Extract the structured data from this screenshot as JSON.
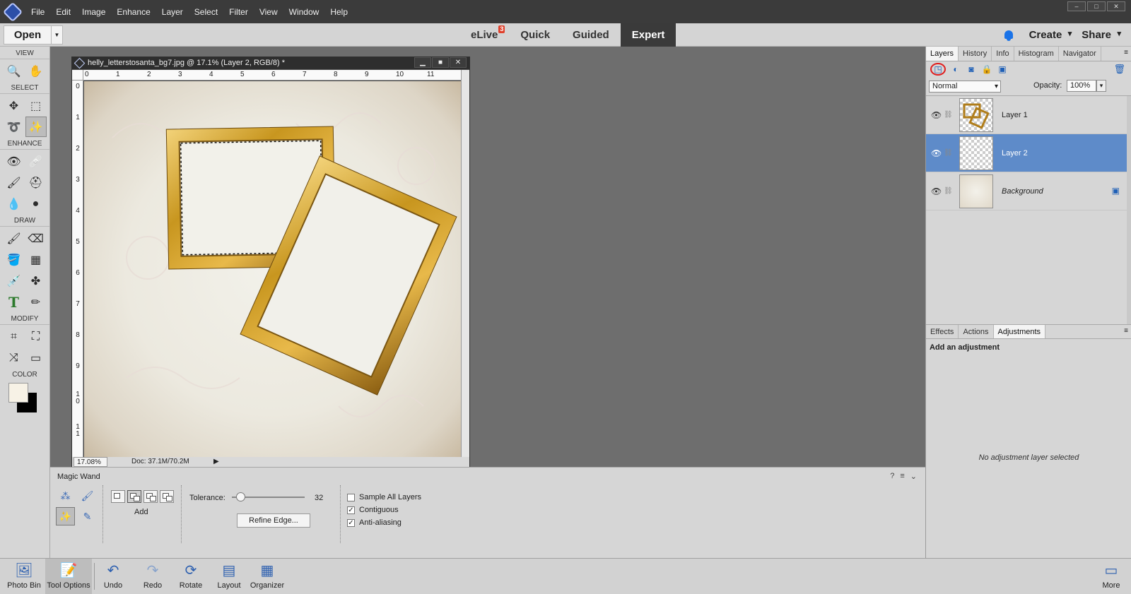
{
  "menubar": {
    "items": [
      "File",
      "Edit",
      "Image",
      "Enhance",
      "Layer",
      "Select",
      "Filter",
      "View",
      "Window",
      "Help"
    ]
  },
  "modebar": {
    "open_label": "Open",
    "modes": [
      {
        "label": "eLive",
        "badge": "3"
      },
      {
        "label": "Quick"
      },
      {
        "label": "Guided"
      },
      {
        "label": "Expert"
      }
    ],
    "create_label": "Create",
    "share_label": "Share"
  },
  "toolbox": {
    "view_label": "VIEW",
    "select_label": "SELECT",
    "enhance_label": "ENHANCE",
    "draw_label": "DRAW",
    "modify_label": "MODIFY",
    "color_label": "COLOR",
    "type_glyph": "T"
  },
  "document": {
    "title": "helly_letterstosanta_bg7.jpg @ 17.1% (Layer 2, RGB/8) *",
    "ruler_h": [
      "0",
      "1",
      "2",
      "3",
      "4",
      "5",
      "6",
      "7",
      "8",
      "9",
      "10",
      "11"
    ],
    "ruler_v": [
      "0",
      "1",
      "2",
      "3",
      "4",
      "5",
      "6",
      "7",
      "8",
      "9",
      "10",
      "11"
    ],
    "zoom": "17.08%",
    "doc_info": "Doc: 37.1M/70.2M"
  },
  "layers_panel": {
    "tabs": [
      "Layers",
      "History",
      "Info",
      "Histogram",
      "Navigator"
    ],
    "blend_mode": "Normal",
    "opacity_label": "Opacity:",
    "opacity_value": "100%",
    "layers": [
      {
        "name": "Layer 1"
      },
      {
        "name": "Layer 2"
      },
      {
        "name": "Background"
      }
    ]
  },
  "adjust_panel": {
    "tabs": [
      "Effects",
      "Actions",
      "Adjustments"
    ],
    "title": "Add an adjustment",
    "empty_message": "No adjustment layer selected"
  },
  "tool_options": {
    "title": "Magic Wand",
    "add_label": "Add",
    "tolerance_label": "Tolerance:",
    "tolerance_value": "32",
    "refine_edge_label": "Refine Edge...",
    "sample_all_layers": "Sample All Layers",
    "contiguous": "Contiguous",
    "anti_aliasing": "Anti-aliasing"
  },
  "bottombar": {
    "items": [
      "Photo Bin",
      "Tool Options",
      "Undo",
      "Redo",
      "Rotate",
      "Layout",
      "Organizer"
    ],
    "more_label": "More"
  },
  "colors": {
    "accent_blue": "#1e5fb6",
    "selected_layer": "#5e8bc9",
    "badge_red": "#e0402b",
    "frame_gold": "#c8961f"
  }
}
